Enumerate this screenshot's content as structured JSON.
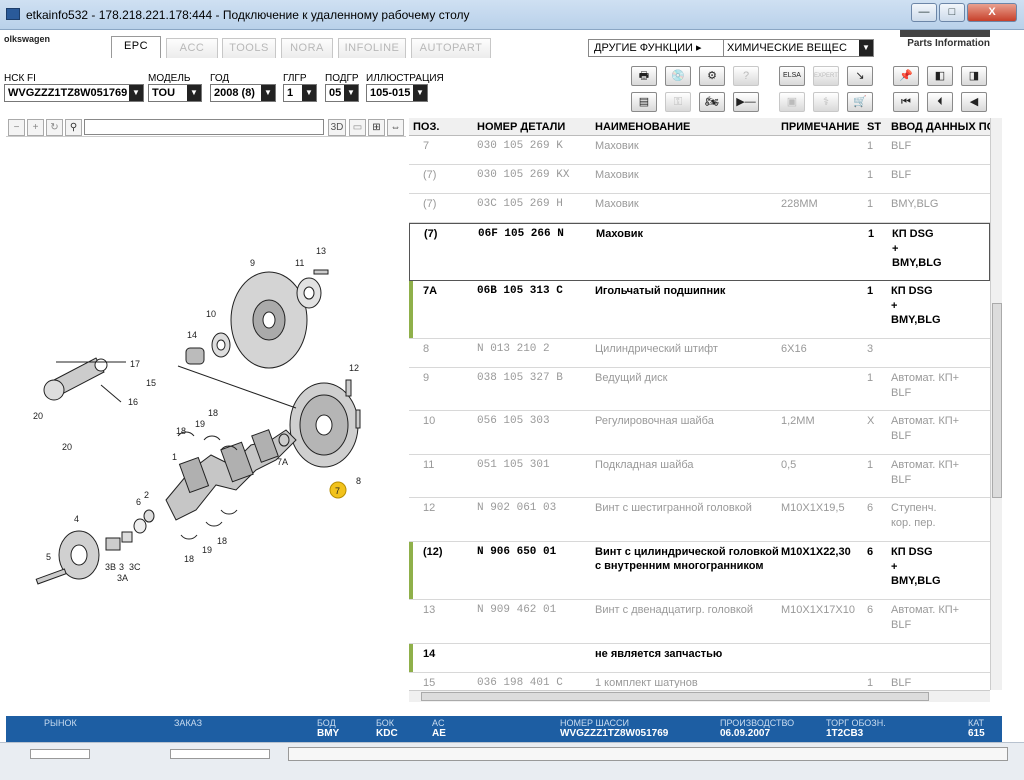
{
  "window": {
    "title": "etkainfo532 - 178.218.221.178:444 - Подключение к удаленному рабочему столу",
    "min": "—",
    "max": "□",
    "close": "X"
  },
  "brand": "olkswagen",
  "tabs": [
    "EPC",
    "ACC",
    "TOOLS",
    "NORA",
    "INFOLINE",
    "AUTOPART"
  ],
  "functions": {
    "label": "ДРУГИЕ ФУНКЦИИ ▸",
    "value": "ХИМИЧЕСКИЕ ВЕЩЕС"
  },
  "parts_info": "Parts Information",
  "selectors": [
    {
      "label": "НСК FI",
      "value": "WVGZZZ1TZ8W051769"
    },
    {
      "label": "МОДЕЛЬ",
      "value": "TOU"
    },
    {
      "label": "ГОД",
      "value": "2008 (8)"
    },
    {
      "label": "ГЛГР",
      "value": "1"
    },
    {
      "label": "ПОДГР",
      "value": "05"
    },
    {
      "label": "ИЛЛЮСТРАЦИЯ",
      "value": "105-015"
    }
  ],
  "toolbar": {
    "row1": [
      "print-icon",
      "disk-icon",
      "parts-icon",
      "search-icon",
      "elsa-icon",
      "expert-icon",
      "cart-in-icon",
      "pin-icon",
      "prev-page-icon",
      "next-page-icon"
    ],
    "row1_labels": [
      "🖶",
      "💿",
      "⚙",
      "?",
      "ELSA",
      "EXPERT",
      "↘",
      "📌",
      "◧",
      "◨"
    ],
    "row2_labels": [
      "▤",
      "⚿",
      "🏍",
      "▶—",
      "▣",
      "⚕",
      "🛒",
      "⏮",
      "⏴",
      "◀"
    ]
  },
  "leftbar": {
    "btn_3d": "3D"
  },
  "table": {
    "headers": [
      "ПОЗ.",
      "НОМЕР ДЕТАЛИ",
      "НАИМЕНОВАНИЕ",
      "ПРИМЕЧАНИЕ",
      "ST",
      "ВВОД ДАННЫХ ПО"
    ],
    "rows": [
      {
        "pos": "7",
        "num": "030 105 269 K",
        "name": "Маховик",
        "note": "",
        "st": "1",
        "data": [
          "BLF"
        ],
        "bold": false
      },
      {
        "pos": "(7)",
        "num": "030 105 269 KX",
        "name": "Маховик",
        "note": "",
        "st": "1",
        "data": [
          "BLF"
        ],
        "bold": false
      },
      {
        "pos": "(7)",
        "num": "03C 105 269 H",
        "name": "Маховик",
        "note": "228MM",
        "st": "1",
        "data": [
          "BMY,BLG"
        ],
        "bold": false
      },
      {
        "pos": "(7)",
        "num": "06F 105 266 N",
        "name": "Маховик",
        "note": "",
        "st": "1",
        "data": [
          "КП DSG",
          "+",
          "BMY,BLG"
        ],
        "bold": true
      },
      {
        "pos": "7A",
        "num": "06B 105 313 C",
        "name": "Игольчатый подшипник",
        "note": "",
        "st": "1",
        "data": [
          "КП DSG",
          "+",
          "BMY,BLG"
        ],
        "bold": true
      },
      {
        "pos": "8",
        "num": "N   013 210 2",
        "name": "Цилиндрический штифт",
        "note": "6X16",
        "st": "3",
        "data": [],
        "bold": false
      },
      {
        "pos": "9",
        "num": "038 105 327 B",
        "name": "Ведущий диск",
        "note": "",
        "st": "1",
        "data": [
          "Автомат. КП+",
          "BLF"
        ],
        "bold": false
      },
      {
        "pos": "10",
        "num": "056 105 303",
        "name": "Регулировочная шайба",
        "note": "1,2MM",
        "st": "X",
        "data": [
          "Автомат. КП+",
          "BLF"
        ],
        "bold": false
      },
      {
        "pos": "11",
        "num": "051 105 301",
        "name": "Подкладная шайба",
        "note": "0,5",
        "st": "1",
        "data": [
          "Автомат. КП+",
          "BLF"
        ],
        "bold": false
      },
      {
        "pos": "12",
        "num": "N   902 061 03",
        "name": "Винт с шестигранной головкой",
        "note": "M10X1X19,5",
        "st": "6",
        "data": [
          "Ступенч.",
          "кор. пер."
        ],
        "bold": false
      },
      {
        "pos": "(12)",
        "num": "N   906 650 01",
        "name": "Винт с цилиндрической головкой",
        "name2": "с внутренним многогранником",
        "note": "M10X1X22,30",
        "st": "6",
        "data": [
          "КП DSG",
          "+",
          "BMY,BLG"
        ],
        "bold": true
      },
      {
        "pos": "13",
        "num": "N   909 462 01",
        "name": "Винт с двенадцатигр. головкой",
        "note": "M10X1X17X10",
        "st": "6",
        "data": [
          "Автомат. КП+",
          "BLF"
        ],
        "bold": false
      },
      {
        "pos": "14",
        "num": "",
        "name": "не является запчастью",
        "note": "",
        "st": "",
        "data": [],
        "bold": true
      },
      {
        "pos": "15",
        "num": "036 198 401 C",
        "name": "1 комплект шатунов",
        "note": "",
        "st": "1",
        "data": [
          "BLF"
        ],
        "bold": false
      }
    ]
  },
  "illustration_labels": [
    "13",
    "9",
    "11",
    "10",
    "14",
    "17",
    "15",
    "16",
    "20",
    "20",
    "12",
    "18",
    "19",
    "18",
    "7A",
    "8",
    "7",
    "6",
    "5",
    "4",
    "3B",
    "3",
    "3C",
    "3A",
    "2",
    "1",
    "19",
    "18",
    "18"
  ],
  "status": {
    "market": {
      "label": "РЫНОК",
      "value": ""
    },
    "order": {
      "label": "ЗАКАЗ",
      "value": ""
    },
    "bod": {
      "label": "БОД",
      "value": "BMY"
    },
    "bok": {
      "label": "БОК",
      "value": "KDC"
    },
    "ac": {
      "label": "AC",
      "value": "AE"
    },
    "chassis": {
      "label": "НОМЕР ШАССИ",
      "value": "WVGZZZ1TZ8W051769"
    },
    "prod": {
      "label": "ПРОИЗВОДСТВО",
      "value": "06.09.2007"
    },
    "trade": {
      "label": "ТОРГ ОБОЗН.",
      "value": "1T2CB3"
    },
    "cat": {
      "label": "КАТ",
      "value": "615"
    }
  },
  "colors": {
    "status_bg": "#1d5ea3",
    "row_marker": "#8fb04a",
    "callout": "#f2c21b"
  }
}
